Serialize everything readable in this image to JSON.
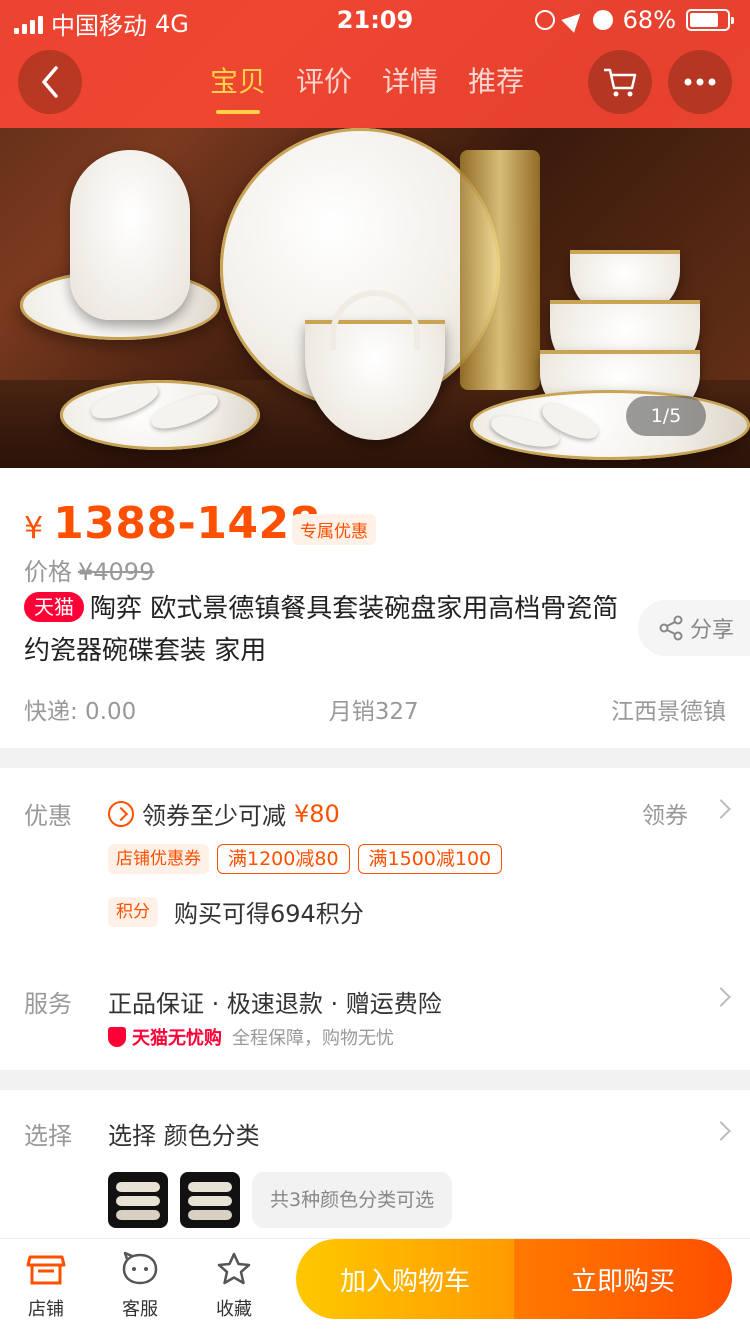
{
  "status_bar": {
    "carrier": "中国移动",
    "network": "4G",
    "time": "21:09",
    "battery": "68%"
  },
  "nav": {
    "tabs": [
      "宝贝",
      "评价",
      "详情",
      "推荐"
    ],
    "active_tab": "宝贝",
    "icons": [
      "back-arrow-icon",
      "cart-icon",
      "more-icon"
    ]
  },
  "gallery": {
    "counter": "1/5"
  },
  "product": {
    "price_symbol": "¥",
    "price_range": "1388-1428",
    "exclusive_badge": "专属优惠",
    "original_label": "价格",
    "original_price": "¥4099",
    "tmall_badge": "天猫",
    "title": "陶弈 欧式景德镇餐具套装碗盘家用高档骨瓷简约瓷器碗碟套装 家用",
    "share_label": "分享",
    "shipping": "快递: 0.00",
    "monthly_sales": "月销327",
    "location": "江西景德镇"
  },
  "promotions": {
    "label": "优惠",
    "coupon_text": "领券至少可减",
    "coupon_amount": "¥80",
    "get_coupon": "领券",
    "shop_coupon_tag": "店铺优惠券",
    "tier1": "满1200减80",
    "tier2": "满1500减100",
    "points_tag": "积分",
    "points_text": "购买可得694积分"
  },
  "service": {
    "label": "服务",
    "items": "正品保证 · 极速退款 · 赠运费险",
    "assure_brand": "天猫无忧购",
    "assure_text": "全程保障，购物无忧"
  },
  "select": {
    "label": "选择",
    "text": "选择  颜色分类",
    "count_text": "共3种颜色分类可选"
  },
  "bottom_bar": {
    "shop": "店铺",
    "service": "客服",
    "favorite": "收藏",
    "add_to_cart": "加入购物车",
    "buy_now": "立即购买"
  },
  "colors": {
    "accent": "#ff5000",
    "tmall_red": "#ff0036",
    "nav_overlay": "#ff4834",
    "active_tab": "#ffd24a",
    "cart_button": "#ffb400",
    "buy_button": "#ff5a00"
  }
}
